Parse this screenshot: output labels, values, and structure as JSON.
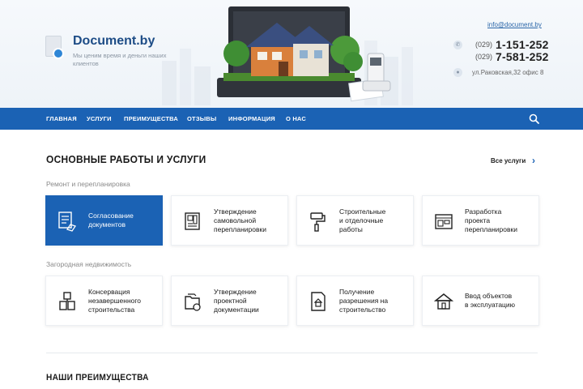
{
  "header": {
    "brand": "Document.by",
    "tagline": "Мы ценим время и деньги наших клиентов",
    "email": "info@document.by",
    "phones": [
      {
        "code": "(029)",
        "number": "1-151-252"
      },
      {
        "code": "(029)",
        "number": "7-581-252"
      }
    ],
    "address": "ул.Раковская,32 офис 8"
  },
  "nav": {
    "items": [
      "ГЛАВНАЯ",
      "УСЛУГИ",
      "ПРЕИМУЩЕСТВА",
      "ОТЗЫВЫ",
      "ИНФОРМАЦИЯ",
      "О НАС"
    ],
    "search_icon": "search-icon"
  },
  "services": {
    "title": "ОСНОВНЫЕ РАБОТЫ И УСЛУГИ",
    "all_link": "Все услуги",
    "groups": [
      {
        "label": "Ремонт и перепланировка",
        "cards": [
          {
            "label": "Согласование\nдокументов",
            "icon": "documents-approval-icon",
            "active": true
          },
          {
            "label": "Утверждение\nсамовольной\nперепланировки",
            "icon": "floor-plan-icon",
            "active": false
          },
          {
            "label": "Строительные\nи отделочные\nработы",
            "icon": "paint-roller-icon",
            "active": false
          },
          {
            "label": "Разработка\nпроекта\nперепланировки",
            "icon": "blueprint-icon",
            "active": false
          }
        ]
      },
      {
        "label": "Загородная недвижимость",
        "cards": [
          {
            "label": "Консервация\nнезавершенного\nстроительства",
            "icon": "construction-icon",
            "active": false
          },
          {
            "label": "Утверждение\nпроектной\nдокументации",
            "icon": "project-docs-icon",
            "active": false
          },
          {
            "label": "Получение\nразрешения на\nстроительство",
            "icon": "building-permit-icon",
            "active": false
          },
          {
            "label": "Ввод объектов\nв эксплуатацию",
            "icon": "house-commissioning-icon",
            "active": false
          }
        ]
      }
    ]
  },
  "advantages": {
    "title": "НАШИ ПРЕИМУЩЕСТВА"
  },
  "colors": {
    "brand_blue": "#1b62b4",
    "brand_text": "#1d4c86",
    "page_bg": "#ffffff"
  }
}
